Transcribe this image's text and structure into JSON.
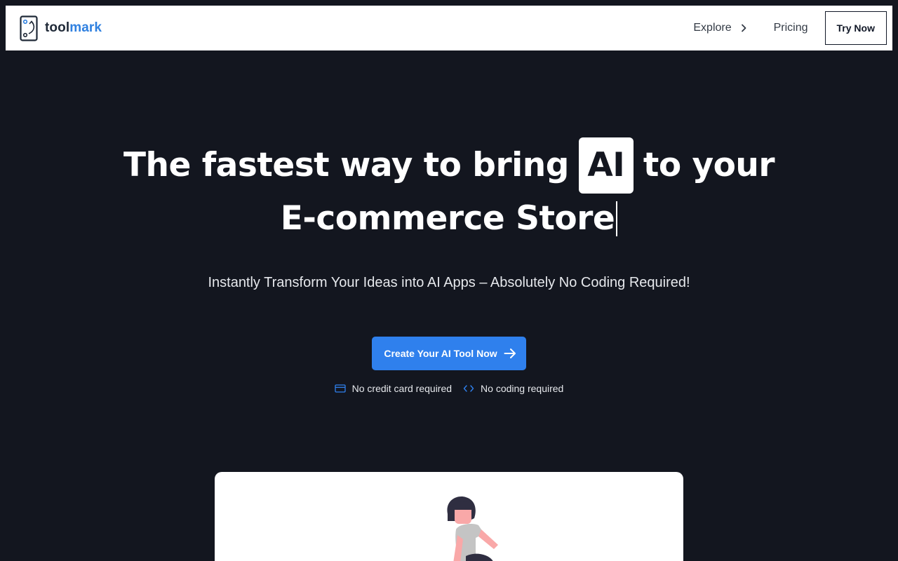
{
  "brand": {
    "name_part1": "tool",
    "name_part2": "mark",
    "logo_icon": "phone-logo-icon",
    "colors": {
      "name_dark": "#1f2937",
      "name_accent": "#2f80e0"
    }
  },
  "nav": {
    "explore_label": "Explore",
    "pricing_label": "Pricing",
    "try_now_label": "Try Now"
  },
  "hero": {
    "headline_part1": "The fastest way to bring",
    "headline_highlight": "AI",
    "headline_part2": "to your",
    "headline_line2": "E-commerce Store",
    "subheadline": "Instantly Transform Your Ideas into AI Apps – Absolutely No Coding Required!",
    "cta_label": "Create Your AI Tool Now",
    "perks": [
      {
        "icon": "credit-card-icon",
        "label": "No credit card required"
      },
      {
        "icon": "code-icon",
        "label": "No coding required"
      }
    ]
  },
  "theme": {
    "background": "#13161f",
    "accent": "#2f80ed",
    "surface": "#ffffff"
  }
}
